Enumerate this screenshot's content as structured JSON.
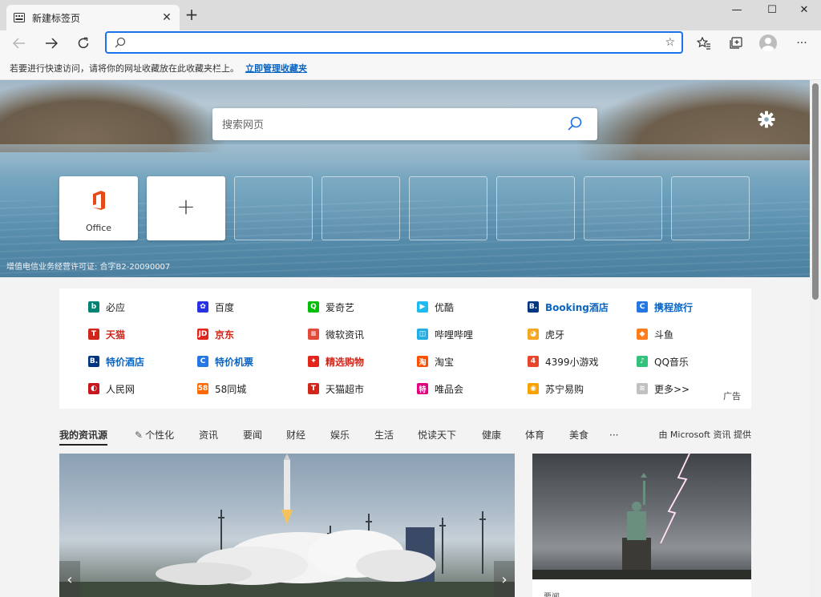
{
  "tab": {
    "title": "新建标签页",
    "close": "✕"
  },
  "newtab": "+",
  "window": {
    "minimize": "—",
    "maximize": "☐",
    "close": "✕"
  },
  "address": {
    "value": "",
    "placeholder": ""
  },
  "favbar": {
    "hint": "若要进行快速访问，请将你的网址收藏放在此收藏夹栏上。",
    "manage_link": "立即管理收藏夹"
  },
  "search": {
    "placeholder": "搜索网页"
  },
  "tiles": [
    {
      "label": "Office",
      "icon": "office-icon"
    },
    {
      "label": "",
      "icon": "plus-icon"
    }
  ],
  "add_tile_symbol": "+",
  "license": "增值电信业务经营许可证: 合字B2-20090007",
  "links": [
    {
      "label": "必应",
      "icon": "bing-icon",
      "style": "normal",
      "color": "#008373",
      "glyph": "b"
    },
    {
      "label": "百度",
      "icon": "baidu-icon",
      "style": "normal",
      "color": "#2932e1",
      "glyph": "✿"
    },
    {
      "label": "爱奇艺",
      "icon": "iqiyi-icon",
      "style": "normal",
      "color": "#00be06",
      "glyph": "Q"
    },
    {
      "label": "优酷",
      "icon": "youku-icon",
      "style": "normal",
      "color": "#1ebaf0",
      "glyph": "▶"
    },
    {
      "label": "Booking酒店",
      "icon": "booking-icon",
      "style": "blue",
      "color": "#003580",
      "glyph": "B."
    },
    {
      "label": "携程旅行",
      "icon": "ctrip-icon",
      "style": "blue",
      "color": "#2577e3",
      "glyph": "C"
    },
    {
      "label": "天猫",
      "icon": "tmall-icon",
      "style": "red",
      "color": "#d1261a",
      "glyph": "T"
    },
    {
      "label": "京东",
      "icon": "jd-icon",
      "style": "red",
      "color": "#e1251b",
      "glyph": "JD"
    },
    {
      "label": "微软资讯",
      "icon": "msn-icon",
      "style": "normal",
      "color": "#e24a3b",
      "glyph": "≡"
    },
    {
      "label": "哔哩哔哩",
      "icon": "bilibili-icon",
      "style": "normal",
      "color": "#23ade5",
      "glyph": "◫"
    },
    {
      "label": "虎牙",
      "icon": "huya-icon",
      "style": "normal",
      "color": "#f5a623",
      "glyph": "◕"
    },
    {
      "label": "斗鱼",
      "icon": "douyu-icon",
      "style": "normal",
      "color": "#ff7d1a",
      "glyph": "◆"
    },
    {
      "label": "特价酒店",
      "icon": "booking-icon-2",
      "style": "blue",
      "color": "#003580",
      "glyph": "B."
    },
    {
      "label": "特价机票",
      "icon": "ctrip-icon-2",
      "style": "blue",
      "color": "#2577e3",
      "glyph": "C"
    },
    {
      "label": "精选购物",
      "icon": "shopping-icon",
      "style": "red",
      "color": "#e1251b",
      "glyph": "✦"
    },
    {
      "label": "淘宝",
      "icon": "taobao-icon",
      "style": "normal",
      "color": "#ff5000",
      "glyph": "淘"
    },
    {
      "label": "4399小游戏",
      "icon": "4399-icon",
      "style": "normal",
      "color": "#e8452c",
      "glyph": "4"
    },
    {
      "label": "QQ音乐",
      "icon": "qqmusic-icon",
      "style": "normal",
      "color": "#31c27c",
      "glyph": "♪"
    },
    {
      "label": "人民网",
      "icon": "people-icon",
      "style": "normal",
      "color": "#c8161d",
      "glyph": "◐"
    },
    {
      "label": "58同城",
      "icon": "58-icon",
      "style": "normal",
      "color": "#ff6a00",
      "glyph": "58"
    },
    {
      "label": "天猫超市",
      "icon": "tmall-market-icon",
      "style": "normal",
      "color": "#d1261a",
      "glyph": "T"
    },
    {
      "label": "唯品会",
      "icon": "vip-icon",
      "style": "normal",
      "color": "#e4007f",
      "glyph": "特"
    },
    {
      "label": "苏宁易购",
      "icon": "suning-icon",
      "style": "normal",
      "color": "#f8a100",
      "glyph": "◉"
    },
    {
      "label": "更多>>",
      "icon": "more-icon",
      "style": "normal",
      "color": "#c0c0c0",
      "glyph": "≋"
    }
  ],
  "ad_tag": "广告",
  "feed_tabs": [
    {
      "label": "我的资讯源",
      "active": true
    },
    {
      "label": "个性化",
      "icon": "pencil-icon"
    },
    {
      "label": "资讯"
    },
    {
      "label": "要闻"
    },
    {
      "label": "财经"
    },
    {
      "label": "娱乐"
    },
    {
      "label": "生活"
    },
    {
      "label": "悦读天下"
    },
    {
      "label": "健康"
    },
    {
      "label": "体育"
    },
    {
      "label": "美食"
    },
    {
      "label": "···"
    }
  ],
  "provider": "由 Microsoft 资讯 提供",
  "news": {
    "small_card_category": "要闻",
    "prev": "‹",
    "next": "›"
  }
}
